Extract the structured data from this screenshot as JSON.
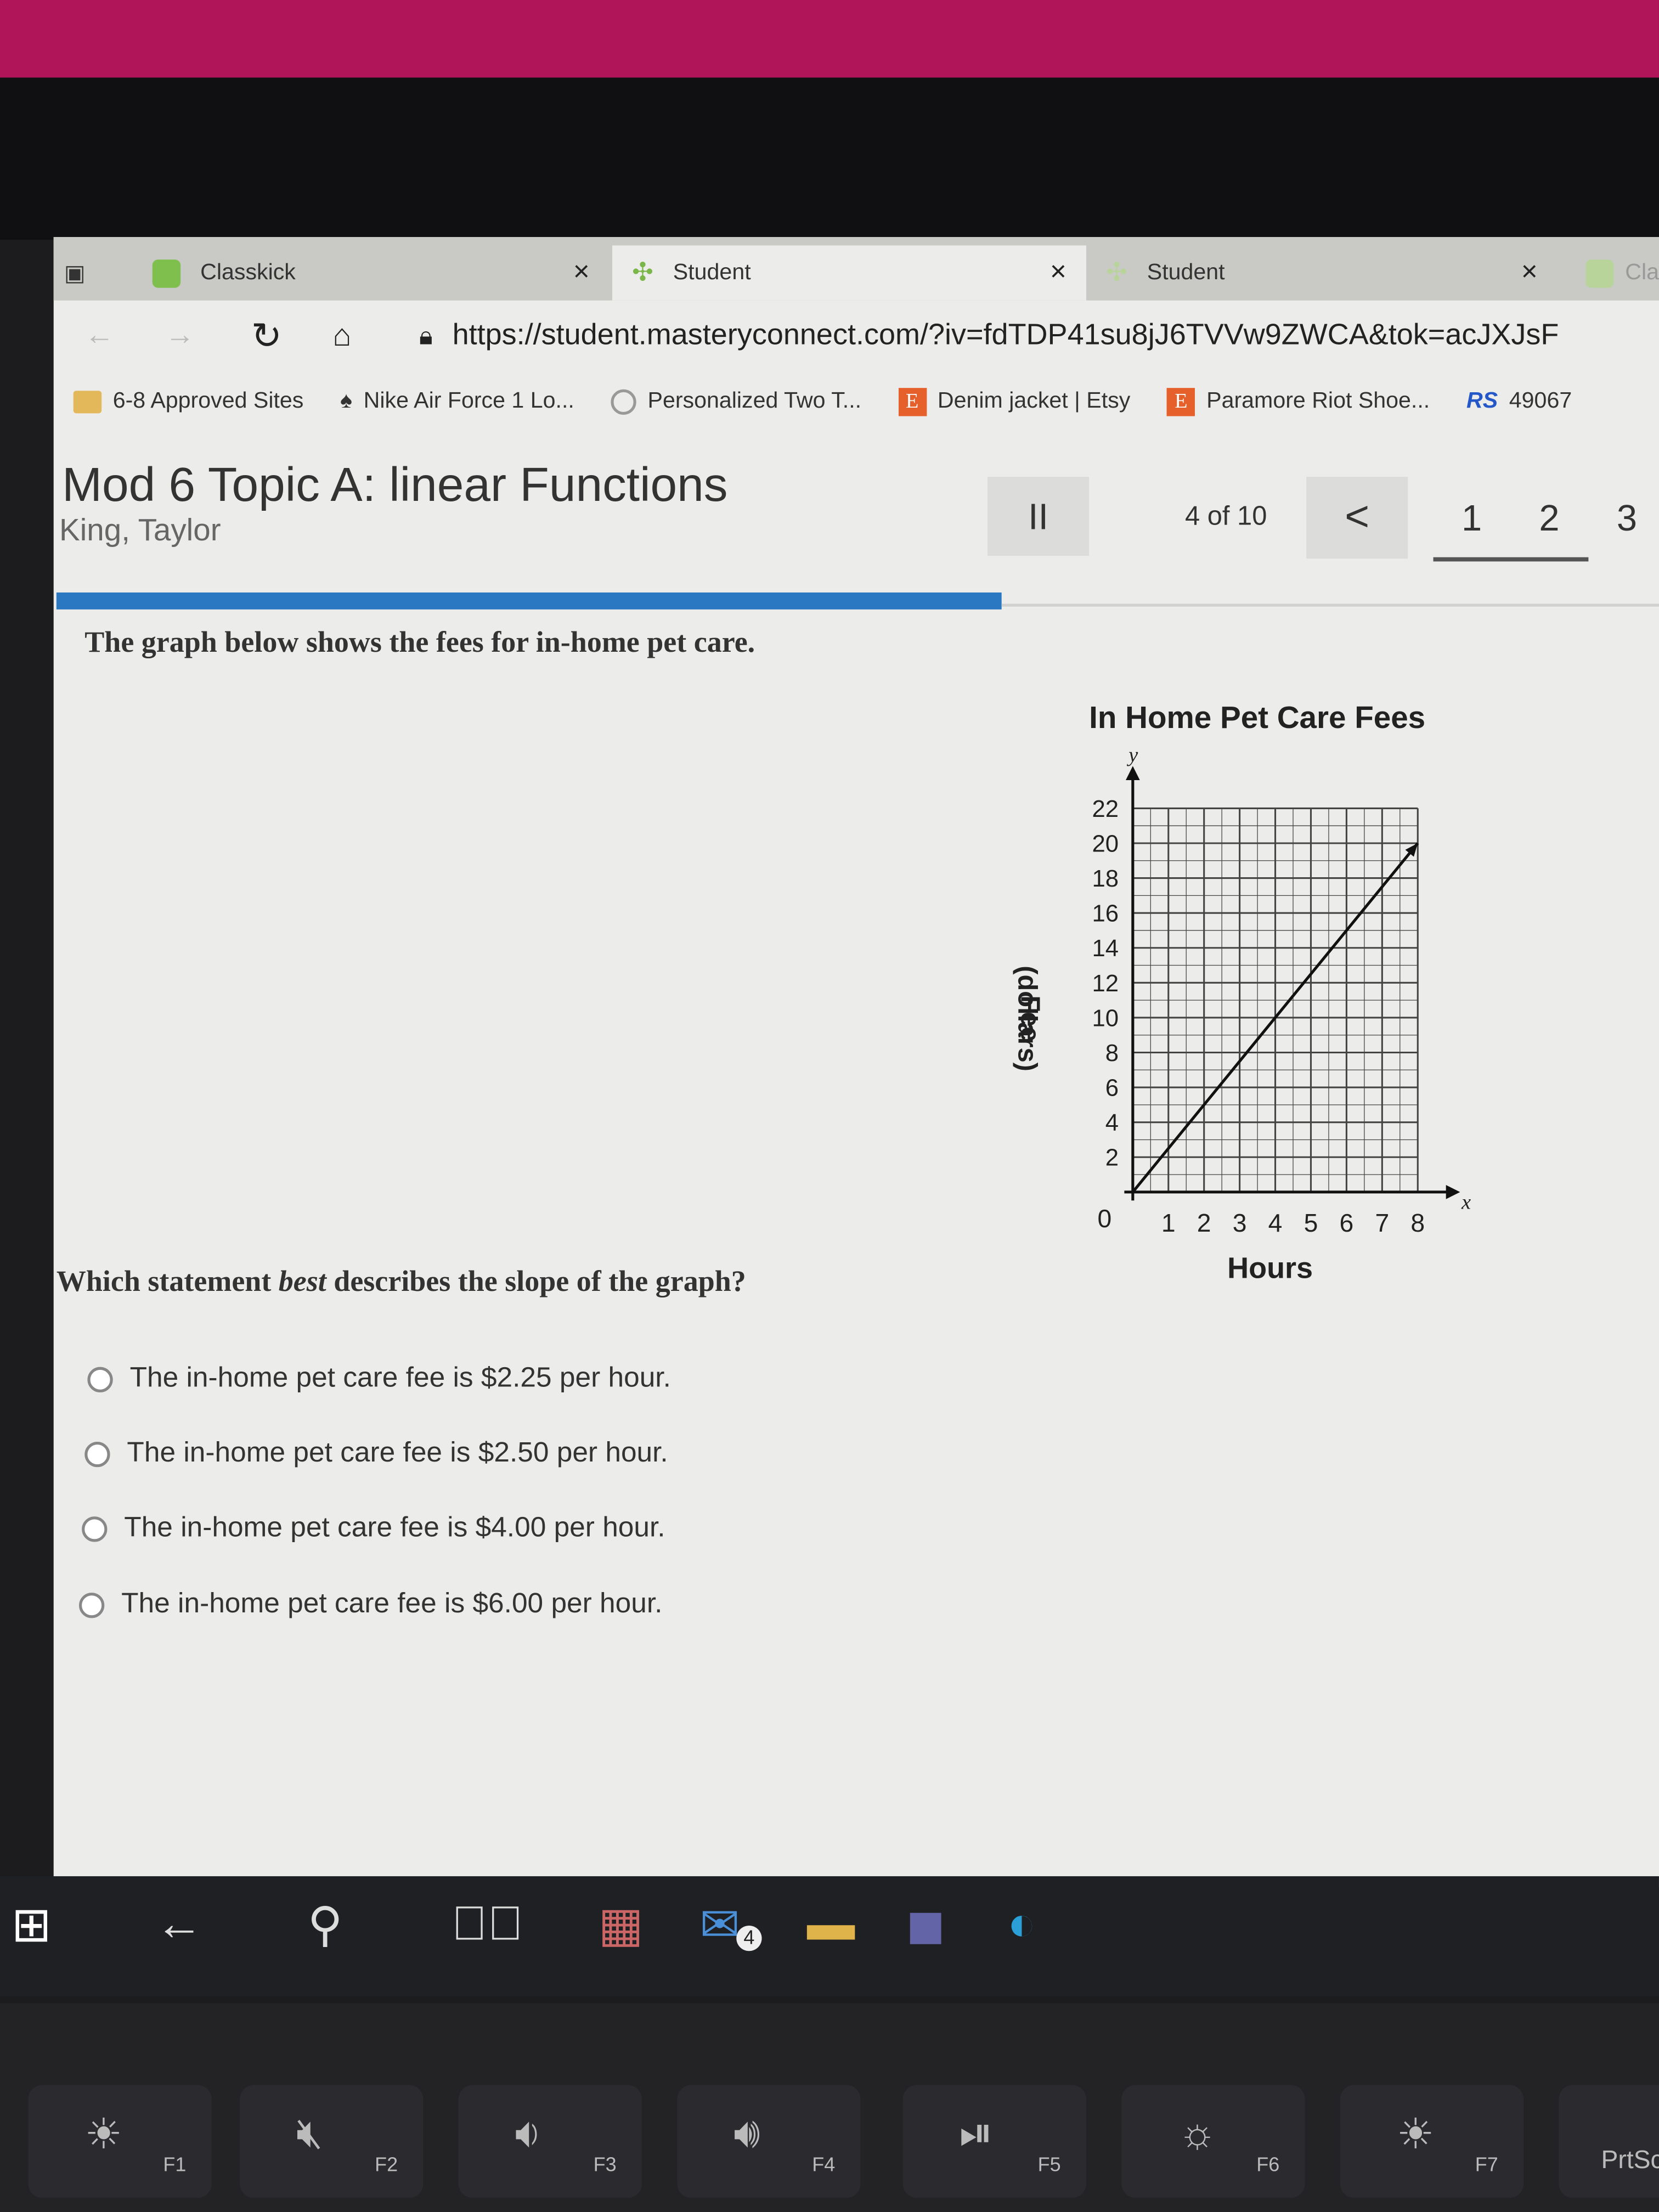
{
  "browser": {
    "tabs": [
      {
        "label": "Classkick",
        "active": false
      },
      {
        "label": "Student",
        "active": true
      },
      {
        "label": "Student",
        "active": false
      },
      {
        "label": "Cla",
        "active": false
      }
    ],
    "url": "https://student.masteryconnect.com/?iv=fdTDP41su8jJ6TVVw9ZWCA&tok=acJXJsF",
    "bookmarks": [
      {
        "label": "6-8 Approved Sites",
        "icon": "folder-icon"
      },
      {
        "label": "Nike Air Force 1 Lo...",
        "icon": "nike-icon"
      },
      {
        "label": "Personalized Two T...",
        "icon": "circle-icon"
      },
      {
        "label": "Denim jacket | Etsy",
        "icon": "etsy-icon",
        "icon_text": "E"
      },
      {
        "label": "Paramore Riot Shoe...",
        "icon": "etsy-icon",
        "icon_text": "E"
      },
      {
        "label": "49067",
        "icon": "rs-icon",
        "icon_text": "RS"
      }
    ]
  },
  "header": {
    "title": "Mod 6 Topic A: linear Functions",
    "student": "King, Taylor",
    "pause_icon": "II",
    "position": "4 of 10",
    "prev_icon": "<",
    "pages": [
      "1",
      "2",
      "3"
    ],
    "accent": "#2a78c2"
  },
  "question": {
    "intro": "The graph below shows the fees for in-home pet care.",
    "prompt_before": "Which statement ",
    "prompt_emph": "best",
    "prompt_after": " describes the slope of the graph?",
    "options": [
      "The in-home pet care fee is $2.25 per hour.",
      "The in-home pet care fee is $2.50 per hour.",
      "The in-home pet care fee is $4.00 per hour.",
      "The in-home pet care fee is $6.00 per hour."
    ]
  },
  "chart_data": {
    "type": "line",
    "title": "In Home Pet Care Fees",
    "xlabel": "Hours",
    "ylabel_line1": "Fee",
    "ylabel_line2": "(dollars)",
    "x_axis_var": "x",
    "y_axis_var": "y",
    "origin_label": "0",
    "xlim": [
      0,
      8
    ],
    "ylim": [
      0,
      22
    ],
    "x_ticks": [
      "1",
      "2",
      "3",
      "4",
      "5",
      "6",
      "7",
      "8"
    ],
    "y_ticks": [
      "2",
      "4",
      "6",
      "8",
      "10",
      "12",
      "14",
      "16",
      "18",
      "20",
      "22"
    ],
    "grid": true,
    "series": [
      {
        "x": [
          0,
          4,
          8
        ],
        "y": [
          0,
          10,
          20
        ]
      }
    ]
  },
  "taskbar": {
    "mail_badge": "4"
  },
  "keyboard": [
    "F1",
    "F2",
    "F3",
    "F4",
    "F5",
    "F6",
    "F7",
    "PrtSc"
  ]
}
